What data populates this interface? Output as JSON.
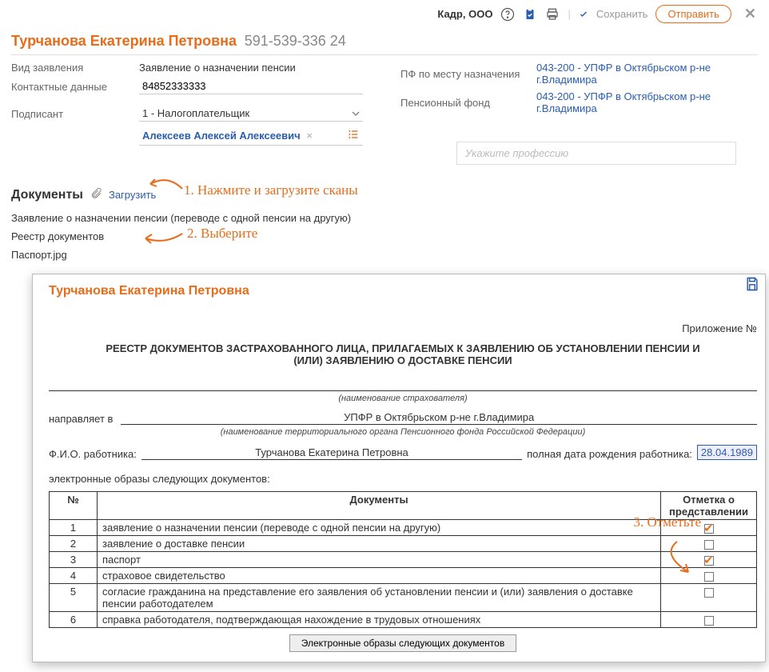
{
  "topbar": {
    "org": "Кадр, ООО",
    "save": "Сохранить",
    "send": "Отправить"
  },
  "person": {
    "name": "Турчанова Екатерина Петровна",
    "snils": "591-539-336 24"
  },
  "form": {
    "type_label": "Вид заявления",
    "type_value": "Заявление о назначении пенсии",
    "contact_label": "Контактные данные",
    "contact_value": "84852333333",
    "signer_label": "Подписант",
    "signer_value": "1 - Налогоплательщик",
    "signer_name": "Алексеев Алексей Алексеевич",
    "pf_place_label": "ПФ по месту назначения",
    "pf_place_value": "043-200 - УПФР в Октябрьском р-не г.Владимира",
    "pf_fund_label": "Пенсионный фонд",
    "pf_fund_value": "043-200 - УПФР в Октябрьском р-не г.Владимира",
    "profession_placeholder": "Укажите профессию"
  },
  "docs": {
    "title": "Документы",
    "upload": "Загрузить",
    "items": [
      "Заявление о назначении пенсии (переводе с одной пенсии на другую)",
      "Реестр документов",
      "Паспорт.jpg"
    ]
  },
  "annotations": {
    "a1": "1. Нажмите и загрузите сканы",
    "a2": "2. Выберите",
    "a3": "3. Отметьте"
  },
  "reestr": {
    "person": "Турчанова Екатерина Петровна",
    "app_no": "Приложение №",
    "title": "РЕЕСТР ДОКУМЕНТОВ ЗАСТРАХОВАННОГО ЛИЦА, ПРИЛАГАЕМЫХ К ЗАЯВЛЕНИЮ ОБ УСТАНОВЛЕНИИ ПЕНСИИ И (ИЛИ) ЗАЯВЛЕНИЮ О ДОСТАВКЕ ПЕНСИИ",
    "insurer_caption": "(наименование страхователя)",
    "send_to_label": "направляет в",
    "send_to_value": "УПФР в Октябрьском р-не г.Владимира",
    "territory_caption": "(наименование территориального органа Пенсионного фонда Российской Федерации)",
    "fio_label": "Ф.И.О. работника:",
    "fio_value": "Турчанова Екатерина Петровна",
    "dob_label": "полная дата рождения работника:",
    "dob_value": "28.04.1989",
    "e_title": "электронные образы следующих документов:",
    "col_num": "№",
    "col_docs": "Документы",
    "col_mark": "Отметка о представлении",
    "rows": [
      {
        "n": "1",
        "doc": "заявление о назначении пенсии (переводе с одной пенсии на другую)",
        "checked": true
      },
      {
        "n": "2",
        "doc": "заявление о доставке пенсии",
        "checked": false
      },
      {
        "n": "3",
        "doc": "паспорт",
        "checked": true
      },
      {
        "n": "4",
        "doc": "страховое свидетельство",
        "checked": false
      },
      {
        "n": "5",
        "doc": "согласие гражданина на представление его заявления об установлении пенсии и (или) заявления о доставке пенсии работодателем",
        "checked": false
      },
      {
        "n": "6",
        "doc": "справка работодателя, подтверждающая нахождение в трудовых отношениях",
        "checked": false
      }
    ],
    "footer_btn": "Электронные образы следующих документов"
  }
}
